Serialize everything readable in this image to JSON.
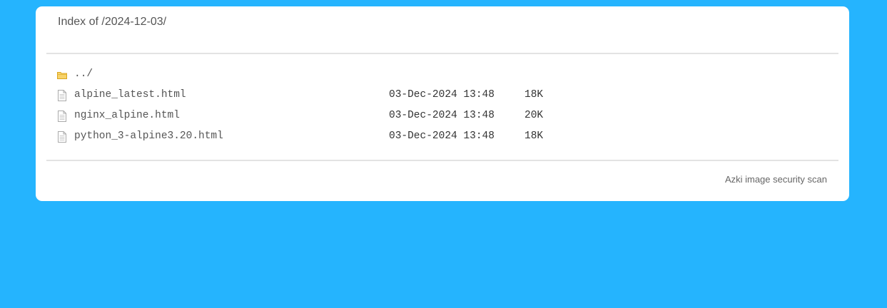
{
  "page": {
    "title": "Index of /2024-12-03/"
  },
  "listing": [
    {
      "icon": "folder-icon",
      "name": "../",
      "date": "",
      "size": ""
    },
    {
      "icon": "file-icon",
      "name": "alpine_latest.html",
      "date": "03-Dec-2024 13:48",
      "size": "18K"
    },
    {
      "icon": "file-icon",
      "name": "nginx_alpine.html",
      "date": "03-Dec-2024 13:48",
      "size": "20K"
    },
    {
      "icon": "file-icon",
      "name": "python_3-alpine3.20.html",
      "date": "03-Dec-2024 13:48",
      "size": "18K"
    }
  ],
  "footer": {
    "text": "Azki image security scan"
  },
  "colors": {
    "background": "#25b4fe",
    "card": "#ffffff",
    "rule": "#e3e3e3",
    "folder": "#f3c440"
  }
}
